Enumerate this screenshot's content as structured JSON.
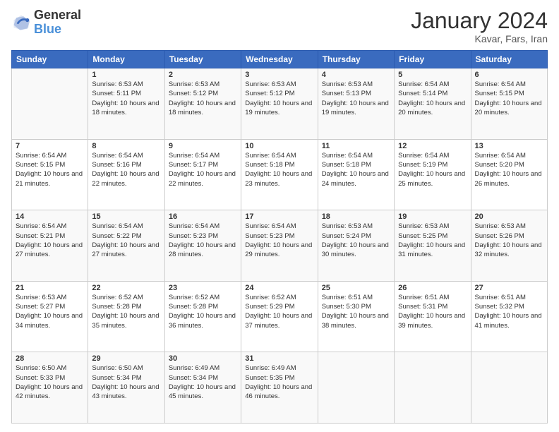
{
  "header": {
    "logo_line1": "General",
    "logo_line2": "Blue",
    "title": "January 2024",
    "subtitle": "Kavar, Fars, Iran"
  },
  "weekdays": [
    "Sunday",
    "Monday",
    "Tuesday",
    "Wednesday",
    "Thursday",
    "Friday",
    "Saturday"
  ],
  "weeks": [
    [
      {
        "day": "",
        "sunrise": "",
        "sunset": "",
        "daylight": ""
      },
      {
        "day": "1",
        "sunrise": "Sunrise: 6:53 AM",
        "sunset": "Sunset: 5:11 PM",
        "daylight": "Daylight: 10 hours and 18 minutes."
      },
      {
        "day": "2",
        "sunrise": "Sunrise: 6:53 AM",
        "sunset": "Sunset: 5:12 PM",
        "daylight": "Daylight: 10 hours and 18 minutes."
      },
      {
        "day": "3",
        "sunrise": "Sunrise: 6:53 AM",
        "sunset": "Sunset: 5:12 PM",
        "daylight": "Daylight: 10 hours and 19 minutes."
      },
      {
        "day": "4",
        "sunrise": "Sunrise: 6:53 AM",
        "sunset": "Sunset: 5:13 PM",
        "daylight": "Daylight: 10 hours and 19 minutes."
      },
      {
        "day": "5",
        "sunrise": "Sunrise: 6:54 AM",
        "sunset": "Sunset: 5:14 PM",
        "daylight": "Daylight: 10 hours and 20 minutes."
      },
      {
        "day": "6",
        "sunrise": "Sunrise: 6:54 AM",
        "sunset": "Sunset: 5:15 PM",
        "daylight": "Daylight: 10 hours and 20 minutes."
      }
    ],
    [
      {
        "day": "7",
        "sunrise": "Sunrise: 6:54 AM",
        "sunset": "Sunset: 5:15 PM",
        "daylight": "Daylight: 10 hours and 21 minutes."
      },
      {
        "day": "8",
        "sunrise": "Sunrise: 6:54 AM",
        "sunset": "Sunset: 5:16 PM",
        "daylight": "Daylight: 10 hours and 22 minutes."
      },
      {
        "day": "9",
        "sunrise": "Sunrise: 6:54 AM",
        "sunset": "Sunset: 5:17 PM",
        "daylight": "Daylight: 10 hours and 22 minutes."
      },
      {
        "day": "10",
        "sunrise": "Sunrise: 6:54 AM",
        "sunset": "Sunset: 5:18 PM",
        "daylight": "Daylight: 10 hours and 23 minutes."
      },
      {
        "day": "11",
        "sunrise": "Sunrise: 6:54 AM",
        "sunset": "Sunset: 5:18 PM",
        "daylight": "Daylight: 10 hours and 24 minutes."
      },
      {
        "day": "12",
        "sunrise": "Sunrise: 6:54 AM",
        "sunset": "Sunset: 5:19 PM",
        "daylight": "Daylight: 10 hours and 25 minutes."
      },
      {
        "day": "13",
        "sunrise": "Sunrise: 6:54 AM",
        "sunset": "Sunset: 5:20 PM",
        "daylight": "Daylight: 10 hours and 26 minutes."
      }
    ],
    [
      {
        "day": "14",
        "sunrise": "Sunrise: 6:54 AM",
        "sunset": "Sunset: 5:21 PM",
        "daylight": "Daylight: 10 hours and 27 minutes."
      },
      {
        "day": "15",
        "sunrise": "Sunrise: 6:54 AM",
        "sunset": "Sunset: 5:22 PM",
        "daylight": "Daylight: 10 hours and 27 minutes."
      },
      {
        "day": "16",
        "sunrise": "Sunrise: 6:54 AM",
        "sunset": "Sunset: 5:23 PM",
        "daylight": "Daylight: 10 hours and 28 minutes."
      },
      {
        "day": "17",
        "sunrise": "Sunrise: 6:54 AM",
        "sunset": "Sunset: 5:23 PM",
        "daylight": "Daylight: 10 hours and 29 minutes."
      },
      {
        "day": "18",
        "sunrise": "Sunrise: 6:53 AM",
        "sunset": "Sunset: 5:24 PM",
        "daylight": "Daylight: 10 hours and 30 minutes."
      },
      {
        "day": "19",
        "sunrise": "Sunrise: 6:53 AM",
        "sunset": "Sunset: 5:25 PM",
        "daylight": "Daylight: 10 hours and 31 minutes."
      },
      {
        "day": "20",
        "sunrise": "Sunrise: 6:53 AM",
        "sunset": "Sunset: 5:26 PM",
        "daylight": "Daylight: 10 hours and 32 minutes."
      }
    ],
    [
      {
        "day": "21",
        "sunrise": "Sunrise: 6:53 AM",
        "sunset": "Sunset: 5:27 PM",
        "daylight": "Daylight: 10 hours and 34 minutes."
      },
      {
        "day": "22",
        "sunrise": "Sunrise: 6:52 AM",
        "sunset": "Sunset: 5:28 PM",
        "daylight": "Daylight: 10 hours and 35 minutes."
      },
      {
        "day": "23",
        "sunrise": "Sunrise: 6:52 AM",
        "sunset": "Sunset: 5:28 PM",
        "daylight": "Daylight: 10 hours and 36 minutes."
      },
      {
        "day": "24",
        "sunrise": "Sunrise: 6:52 AM",
        "sunset": "Sunset: 5:29 PM",
        "daylight": "Daylight: 10 hours and 37 minutes."
      },
      {
        "day": "25",
        "sunrise": "Sunrise: 6:51 AM",
        "sunset": "Sunset: 5:30 PM",
        "daylight": "Daylight: 10 hours and 38 minutes."
      },
      {
        "day": "26",
        "sunrise": "Sunrise: 6:51 AM",
        "sunset": "Sunset: 5:31 PM",
        "daylight": "Daylight: 10 hours and 39 minutes."
      },
      {
        "day": "27",
        "sunrise": "Sunrise: 6:51 AM",
        "sunset": "Sunset: 5:32 PM",
        "daylight": "Daylight: 10 hours and 41 minutes."
      }
    ],
    [
      {
        "day": "28",
        "sunrise": "Sunrise: 6:50 AM",
        "sunset": "Sunset: 5:33 PM",
        "daylight": "Daylight: 10 hours and 42 minutes."
      },
      {
        "day": "29",
        "sunrise": "Sunrise: 6:50 AM",
        "sunset": "Sunset: 5:34 PM",
        "daylight": "Daylight: 10 hours and 43 minutes."
      },
      {
        "day": "30",
        "sunrise": "Sunrise: 6:49 AM",
        "sunset": "Sunset: 5:34 PM",
        "daylight": "Daylight: 10 hours and 45 minutes."
      },
      {
        "day": "31",
        "sunrise": "Sunrise: 6:49 AM",
        "sunset": "Sunset: 5:35 PM",
        "daylight": "Daylight: 10 hours and 46 minutes."
      },
      {
        "day": "",
        "sunrise": "",
        "sunset": "",
        "daylight": ""
      },
      {
        "day": "",
        "sunrise": "",
        "sunset": "",
        "daylight": ""
      },
      {
        "day": "",
        "sunrise": "",
        "sunset": "",
        "daylight": ""
      }
    ]
  ]
}
